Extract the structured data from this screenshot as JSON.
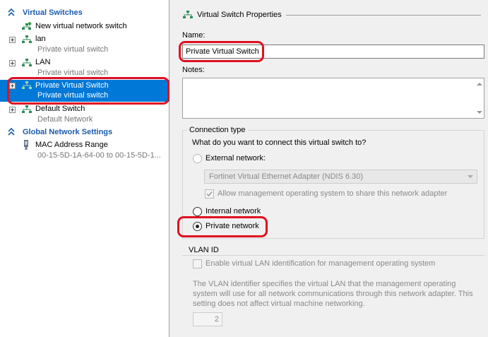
{
  "left": {
    "virtual_switches_header": "Virtual Switches",
    "items": [
      {
        "name": "New virtual network switch",
        "sub": ""
      },
      {
        "name": "lan",
        "sub": "Private virtual switch"
      },
      {
        "name": "LAN",
        "sub": "Private virtual switch"
      },
      {
        "name": "Private Virtual Switch",
        "sub": "Private virtual switch"
      },
      {
        "name": "Default Switch",
        "sub": "Default Network"
      }
    ],
    "global_header": "Global Network Settings",
    "mac": {
      "name": "MAC Address Range",
      "sub": "00-15-5D-1A-64-00 to 00-15-5D-1..."
    }
  },
  "right": {
    "title": "Virtual Switch Properties",
    "name_label": "Name:",
    "name_value": "Private Virtual Switch",
    "notes_label": "Notes:",
    "notes_value": "",
    "connection_type": {
      "title": "Connection type",
      "question": "What do you want to connect this virtual switch to?",
      "external_label": "External network:",
      "adapter_value": "Fortinet Virtual Ethernet Adapter (NDIS 6.30)",
      "allow_mgmt_label": "Allow management operating system to share this network adapter",
      "allow_mgmt_checked": true,
      "internal_label": "Internal network",
      "private_label": "Private network",
      "selected": "private"
    },
    "vlan": {
      "title": "VLAN ID",
      "enable_label": "Enable virtual LAN identification for management operating system",
      "enable_checked": false,
      "description": "The VLAN identifier specifies the virtual LAN that the management operating system will use for all network communications through this network adapter. This setting does not affect virtual machine networking.",
      "vlan_value": "2"
    }
  },
  "colors": {
    "selection": "#0078d7",
    "header_text": "#1c5bab",
    "highlight_outline": "#e01020"
  }
}
